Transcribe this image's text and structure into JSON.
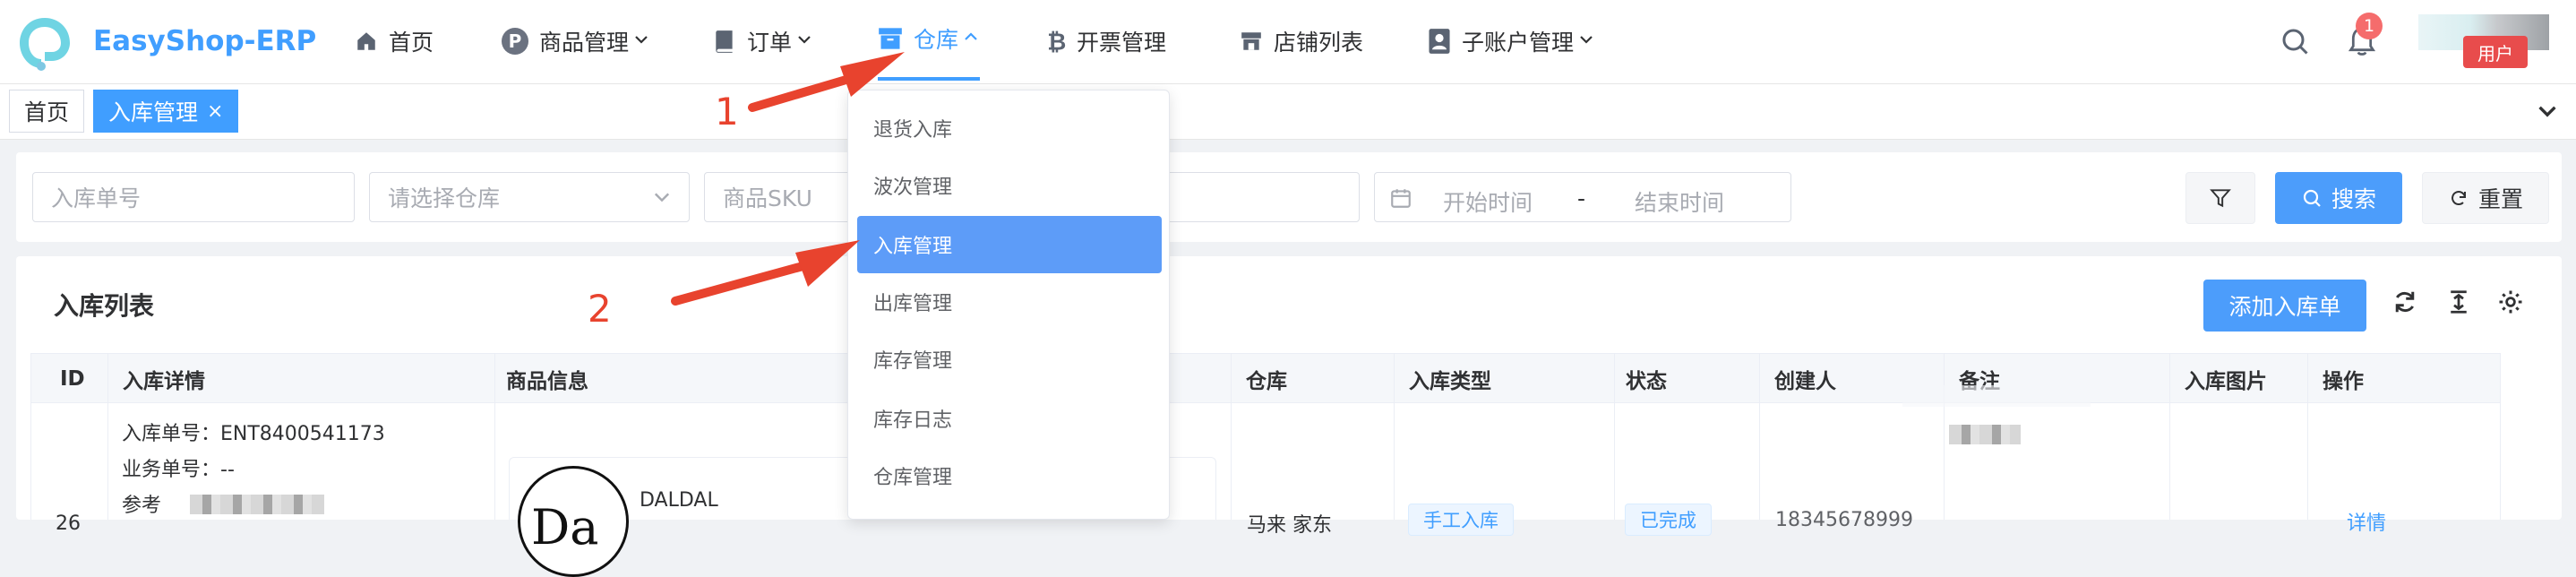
{
  "app": {
    "brand": "EasyShop-ERP"
  },
  "nav": {
    "home": "首页",
    "products": "商品管理",
    "orders": "订单",
    "warehouse": "仓库",
    "invoice": "开票管理",
    "stores": "店铺列表",
    "subaccounts": "子账户管理"
  },
  "header": {
    "notification_count": "1",
    "user_label": "用户"
  },
  "tabs": [
    {
      "label": "首页"
    },
    {
      "label": "入库管理"
    }
  ],
  "filters": {
    "inbound_no_placeholder": "入库单号",
    "warehouse_placeholder": "请选择仓库",
    "sku_placeholder": "商品SKU",
    "start_time": "开始时间",
    "range_separator": "-",
    "end_time": "结束时间",
    "search_label": "搜索",
    "reset_label": "重置"
  },
  "list": {
    "title": "入库列表",
    "add_label": "添加入库单",
    "columns": [
      "ID",
      "入库详情",
      "商品信息",
      "仓库",
      "入库类型",
      "状态",
      "创建人",
      "备注",
      "入库图片",
      "操作"
    ],
    "row": {
      "id": "26",
      "inbound_no": "入库单号：ENT8400541173",
      "business_no": "业务单号：--",
      "reference": "参考",
      "product_name": "DALDAL",
      "warehouse": "马来 家东",
      "type": "手工入库",
      "status": "已完成",
      "creator": "18345678999",
      "action": "详情"
    }
  },
  "dropdown": {
    "items": [
      "退货入库",
      "波次管理",
      "入库管理",
      "出库管理",
      "库存管理",
      "库存日志",
      "仓库管理"
    ],
    "selected_index": 2
  },
  "annotations": {
    "step1": "1",
    "step2": "2"
  },
  "colors": {
    "accent": "#409eff",
    "danger": "#f56c6c",
    "annotation": "#e8432e"
  }
}
